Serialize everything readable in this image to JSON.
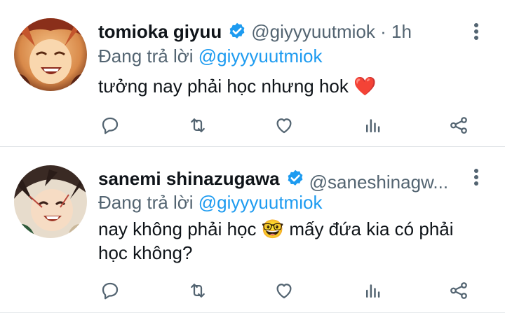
{
  "tweets": [
    {
      "display_name": "tomioka giyuu",
      "handle": "@giyyyuutmiok",
      "separator": " · ",
      "time": "1h",
      "reply_prefix": "Đang trả lời ",
      "reply_to": "@giyyyuutmiok",
      "text": "tưởng nay phải học nhưng hok ❤️",
      "avatar_icon": "avatar-image"
    },
    {
      "display_name": "sanemi shinazugawa",
      "handle": "@saneshinagw...",
      "reply_prefix": "Đang trả lời ",
      "reply_to": "@giyyyuutmiok",
      "text": "nay không phải học 🤓 mấy đứa kia có phải học không?",
      "avatar_icon": "avatar-image"
    }
  ],
  "icons": {
    "verified": "verified-badge-icon",
    "more": "more-vertical-icon",
    "reply": "reply-icon",
    "retweet": "retweet-icon",
    "like": "heart-icon",
    "views": "views-icon",
    "share": "share-icon"
  },
  "colors": {
    "accent": "#1d9bf0",
    "secondary_text": "#536471",
    "primary_text": "#0f1419",
    "icon": "#536471"
  }
}
